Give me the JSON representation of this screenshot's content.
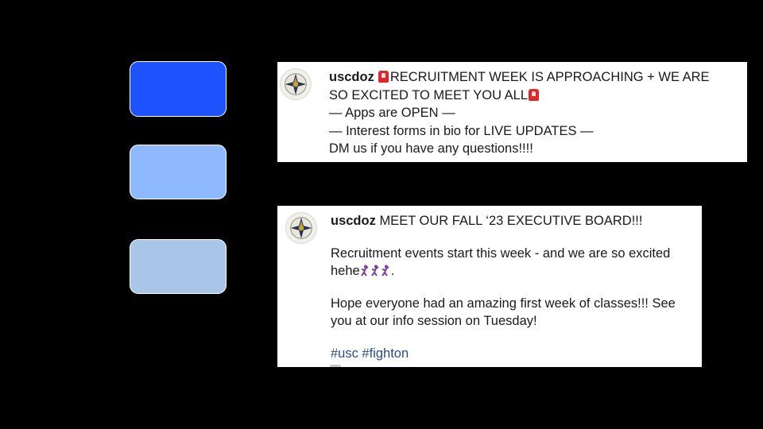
{
  "palette": {
    "swatches": [
      "#1f52ff",
      "#8eb9ff",
      "#a9c6e8"
    ],
    "background": "#000000",
    "hashtag_color": "#2c4d85"
  },
  "post1": {
    "username": "uscdoz",
    "line1": "RECRUITMENT WEEK IS APPROACHING + WE ARE",
    "line2": "SO EXCITED TO MEET YOU ALL",
    "line3": "— Apps are OPEN —",
    "line4": "— Interest forms in bio for LIVE UPDATES —",
    "line5": "DM us if you have any questions!!!!",
    "emoji": "rotating-light-icon"
  },
  "post2": {
    "username": "uscdoz",
    "headline": "MEET OUR FALL ‘23 EXECUTIVE BOARD!!!",
    "p1_line1": "Recruitment events start this week - and we are so excited",
    "p1_line2_prefix": "hehe",
    "p1_line2_suffix": ".",
    "p2_line1": "Hope everyone had an amazing first week of classes!!! See",
    "p2_line2": "you at our info session on Tuesday!",
    "hashtags": "#usc #fighton",
    "emoji": "dancer-icon"
  }
}
